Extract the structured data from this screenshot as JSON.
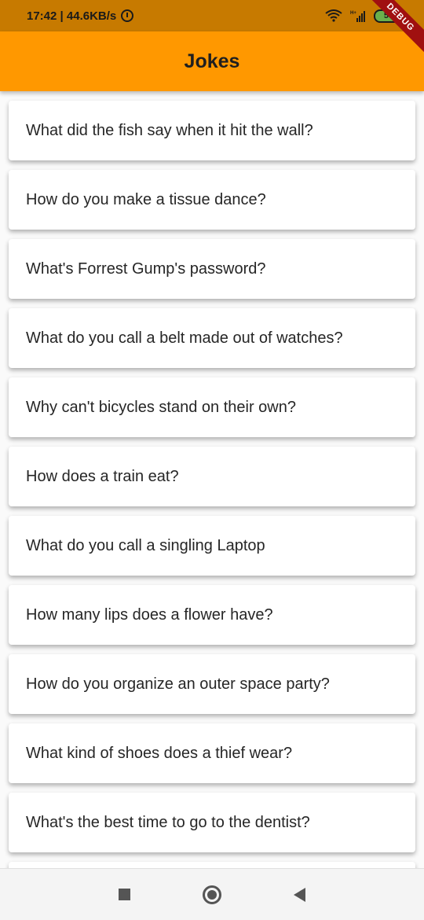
{
  "status_bar": {
    "time_speed": "17:42 | 44.6KB/s",
    "battery": "59",
    "network_label": "H+"
  },
  "debug_banner": "DEBUG",
  "app_bar": {
    "title": "Jokes"
  },
  "jokes": [
    "What did the fish say when it hit the wall?",
    "How do you make a tissue dance?",
    "What's Forrest Gump's password?",
    "What do you call a belt made out of watches?",
    "Why can't bicycles stand on their own?",
    "How does a train eat?",
    "What do you call a singling Laptop",
    "How many lips does a flower have?",
    "How do you organize an outer space party?",
    "What kind of shoes does a thief wear?",
    "What's the best time to go to the dentist?"
  ],
  "colors": {
    "app_bar": "#ff9800",
    "status_bar": "#c77a00",
    "card": "#ffffff",
    "debug": "#a01010"
  },
  "icons": {
    "alarm": "alarm-icon",
    "wifi": "wifi-icon",
    "signal": "signal-icon",
    "battery": "battery-icon",
    "recents": "square-icon",
    "home": "circle-icon",
    "back": "back-triangle-icon"
  }
}
